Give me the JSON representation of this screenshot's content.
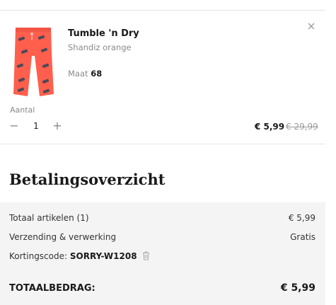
{
  "cart_item": {
    "name": "Tumble 'n Dry",
    "variant": "Shandiz orange",
    "size_label": "Maat",
    "size_value": "68",
    "remove_icon": "close-icon",
    "quantity_label": "Aantal",
    "quantity_value": "1",
    "minus_symbol": "−",
    "plus_symbol": "+",
    "price_now": "€ 5,99",
    "price_old": "€ 29,99",
    "product_color": "#ff5f4c"
  },
  "summary": {
    "title": "Betalingsoverzicht",
    "items_label": "Totaal artikelen (1)",
    "items_value": "€ 5,99",
    "shipping_label": "Verzending & verwerking",
    "shipping_value": "Gratis",
    "coupon_label": "Kortingscode:",
    "coupon_code": "SORRY-W1208",
    "coupon_remove_icon": "trash-icon",
    "total_label": "TOTAALBEDRAG:",
    "total_value": "€ 5,99"
  }
}
